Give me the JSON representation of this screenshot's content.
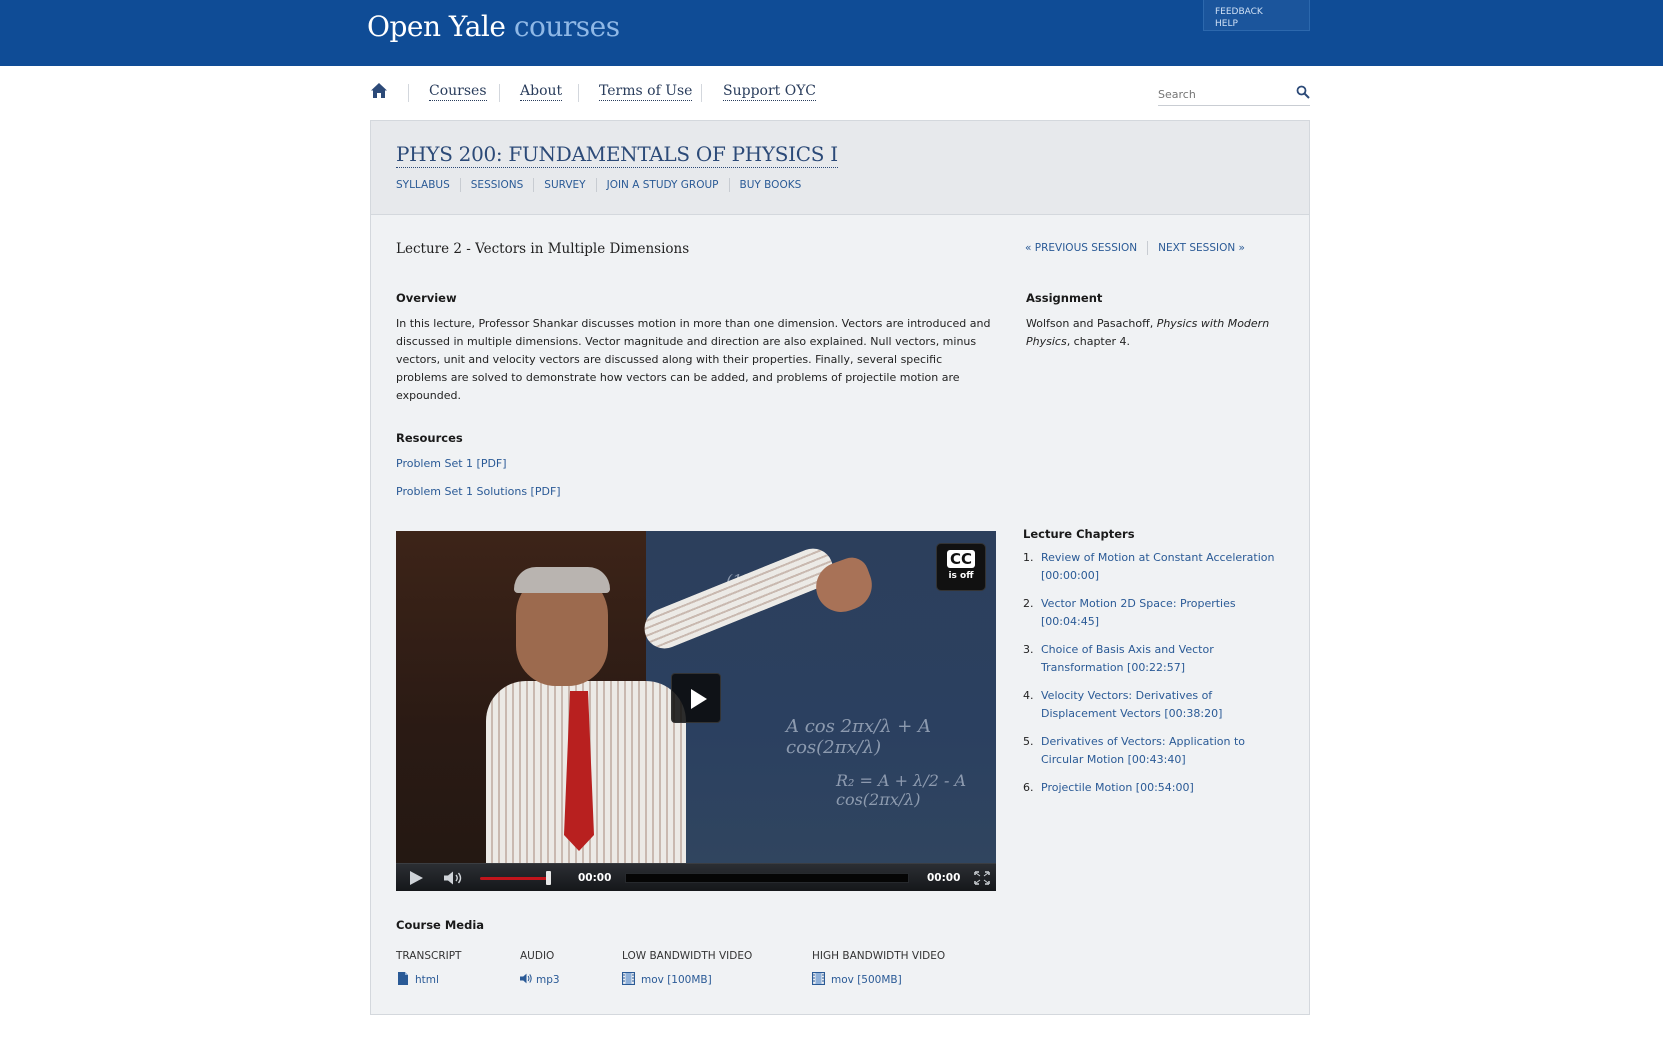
{
  "header": {
    "logo_main": "Open Yale",
    "logo_accent": "courses",
    "feedback": "FEEDBACK",
    "help": "HELP"
  },
  "nav": {
    "items": [
      {
        "label": "Courses"
      },
      {
        "label": "About"
      },
      {
        "label": "Terms of Use"
      },
      {
        "label": "Support OYC"
      }
    ],
    "search_placeholder": "Search"
  },
  "course": {
    "title": "PHYS 200: FUNDAMENTALS OF PHYSICS I",
    "subnav": [
      "SYLLABUS",
      "SESSIONS",
      "SURVEY",
      "JOIN A STUDY GROUP",
      "BUY BOOKS"
    ]
  },
  "lecture": {
    "title": "Lecture 2 - Vectors in Multiple Dimensions",
    "prev": "« PREVIOUS SESSION",
    "next": "NEXT SESSION »",
    "overview_heading": "Overview",
    "overview_text": "In this lecture, Professor Shankar discusses motion in more than one dimension. Vectors are introduced and discussed in multiple dimensions. Vector magnitude and direction are also explained. Null vectors, minus vectors, unit and velocity vectors are discussed along with their properties. Finally, several specific problems are solved to demonstrate how vectors can be added, and problems of projectile motion are expounded.",
    "assignment_heading": "Assignment",
    "assignment_prefix": "Wolfson and Pasachoff, ",
    "assignment_book": "Physics with Modern Physics",
    "assignment_suffix": ", chapter 4.",
    "resources_heading": "Resources",
    "resources": [
      "Problem Set 1 [PDF]",
      "Problem Set 1 Solutions [PDF]"
    ]
  },
  "video": {
    "cc_big": "CC",
    "cc_small": "is off",
    "time_current": "00:00",
    "time_total": "00:00",
    "volume_level": 0.95
  },
  "chapters": {
    "heading": "Lecture Chapters",
    "items": [
      {
        "num": "1.",
        "text": "Review of Motion at Constant Acceleration [00:00:00]"
      },
      {
        "num": "2.",
        "text": "Vector Motion 2D Space: Properties [00:04:45]"
      },
      {
        "num": "3.",
        "text": "Choice of Basis Axis and Vector Transformation [00:22:57]"
      },
      {
        "num": "4.",
        "text": "Velocity Vectors: Derivatives of Displacement Vectors [00:38:20]"
      },
      {
        "num": "5.",
        "text": "Derivatives of Vectors: Application to Circular Motion [00:43:40]"
      },
      {
        "num": "6.",
        "text": "Projectile Motion [00:54:00]"
      }
    ]
  },
  "media": {
    "heading": "Course Media",
    "items": [
      {
        "label": "TRANSCRIPT",
        "link": "html",
        "icon": "document-icon"
      },
      {
        "label": "AUDIO",
        "link": "mp3",
        "icon": "speaker-icon"
      },
      {
        "label": "LOW BANDWIDTH VIDEO",
        "link": "mov [100MB]",
        "icon": "film-icon"
      },
      {
        "label": "HIGH BANDWIDTH VIDEO",
        "link": "mov [500MB]",
        "icon": "film-icon"
      }
    ]
  },
  "colors": {
    "header_blue": "#0f4c96",
    "link_blue": "#2a5a96",
    "panel_bg": "#f0f2f4",
    "volume_red": "#c2141b"
  }
}
